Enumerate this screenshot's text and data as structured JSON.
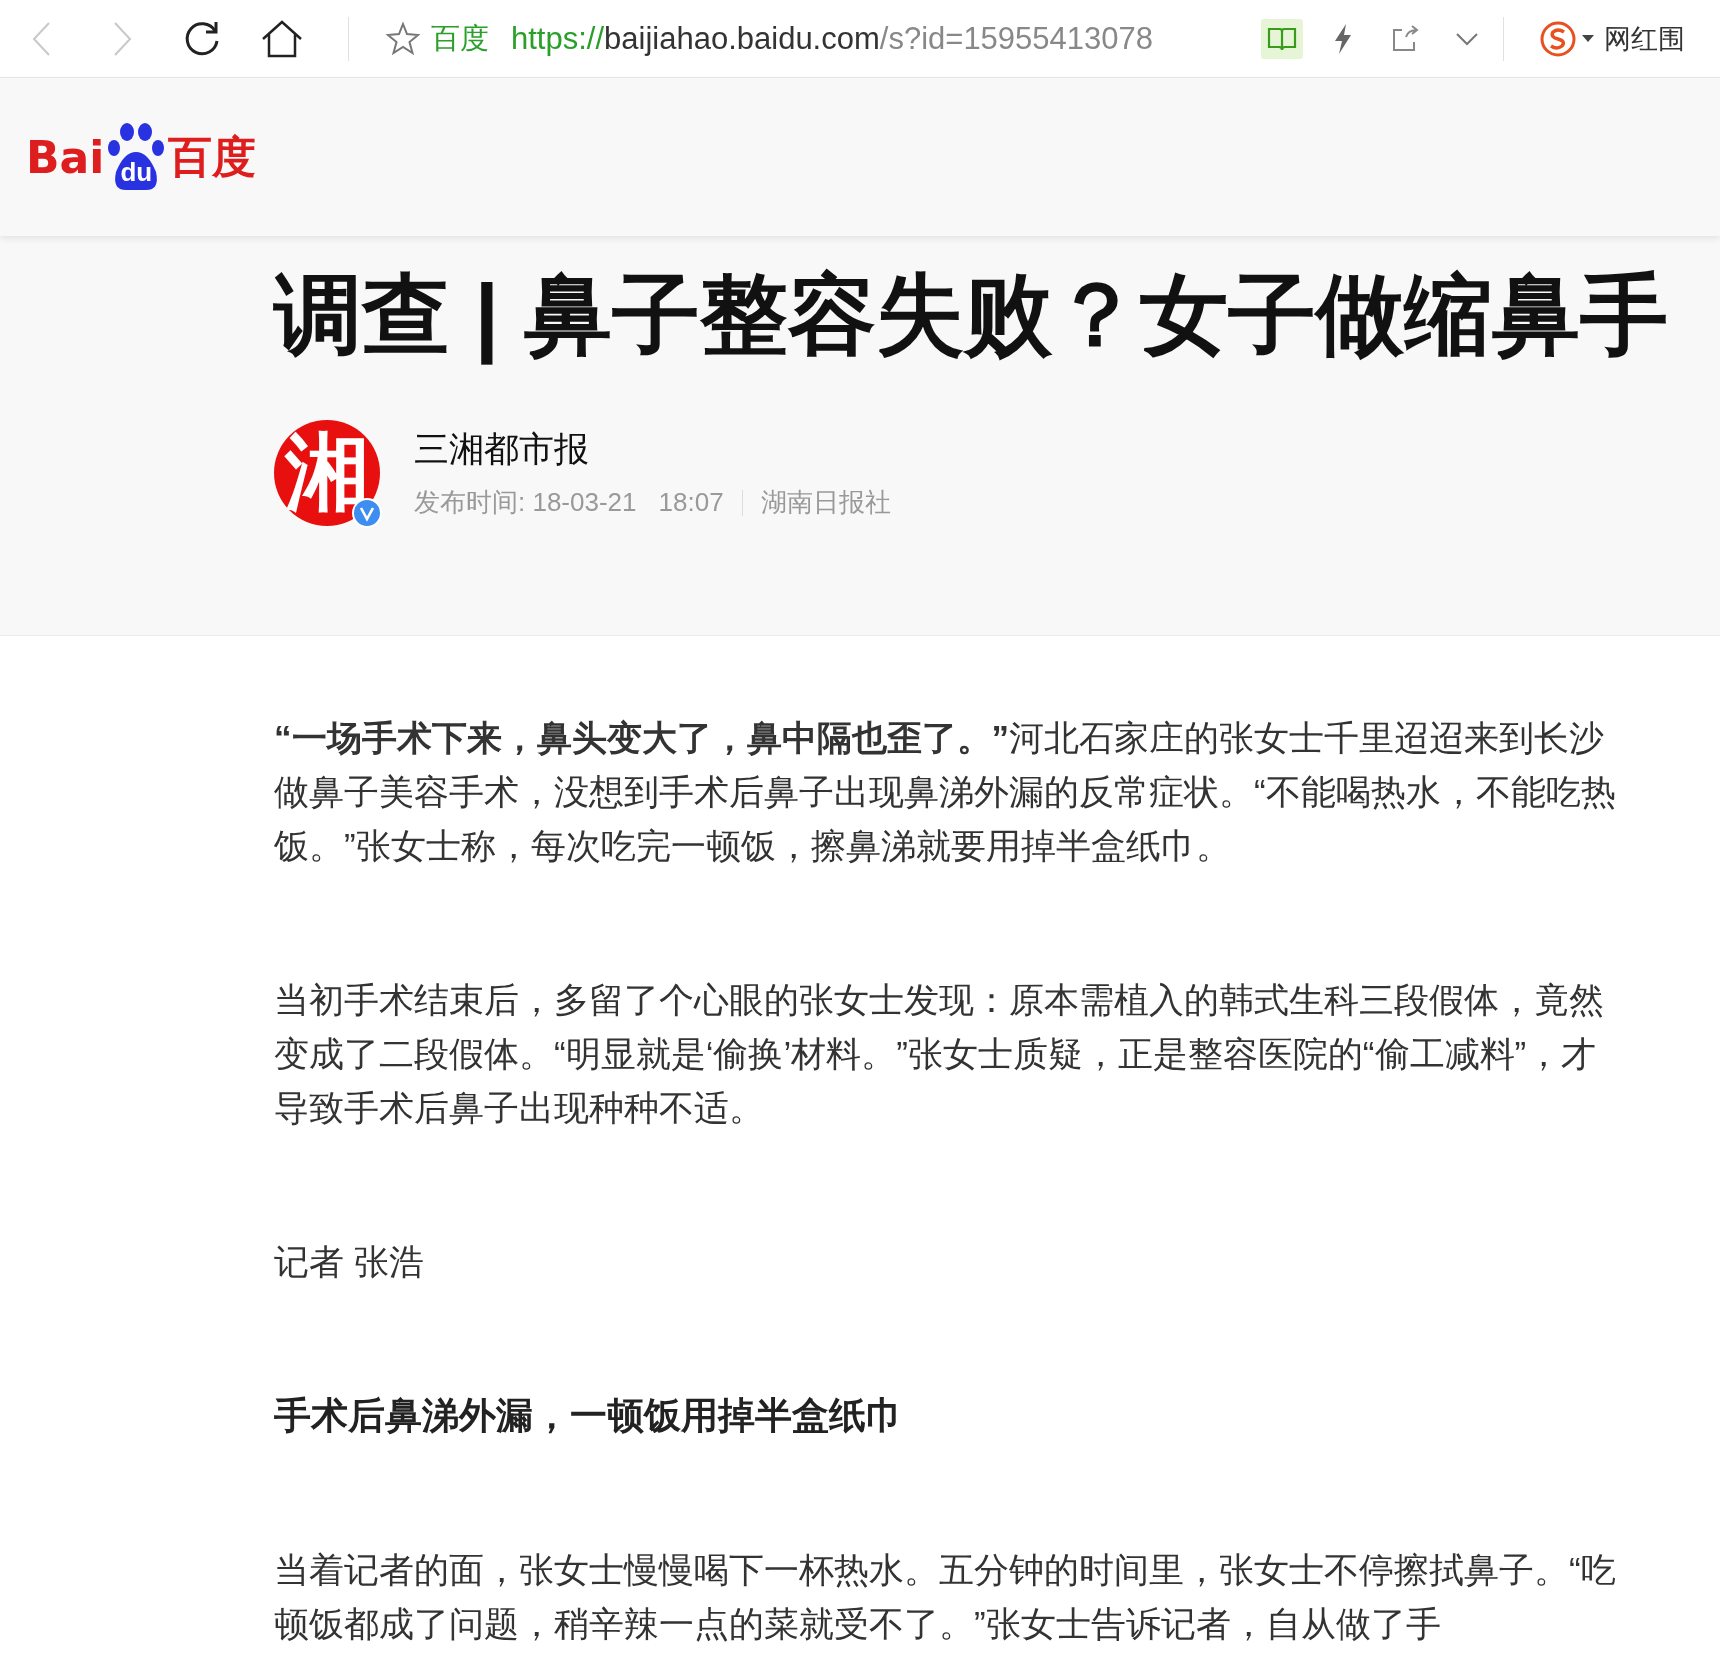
{
  "browser": {
    "back_disabled": true,
    "forward_disabled": true,
    "site_label": "百度",
    "url": {
      "scheme": "https://",
      "host": "baijiahao.baidu.com",
      "path": "/s?id=15955413078"
    },
    "search_text": "网红围"
  },
  "header": {
    "logo": {
      "left": "Bai",
      "mid": "du",
      "right": "百度"
    }
  },
  "article": {
    "title": "调查 | 鼻子整容失败？女子做缩鼻手",
    "author": {
      "avatar_text": "湘",
      "verified": true,
      "name": "三湘都市报",
      "published_label": "发布时间: 18-03-21",
      "time": "18:07",
      "source": "湖南日报社"
    },
    "blocks": [
      {
        "kind": "paragraph",
        "text": "**“一场手术下来，鼻头变大了，鼻中隔也歪了。”**河北石家庄的张女士千里迢迢来到长沙做鼻子美容手术，没想到手术后鼻子出现鼻涕外漏的反常症状。“不能喝热水，不能吃热饭。”张女士称，每次吃完一顿饭，擦鼻涕就要用掉半盒纸巾。"
      },
      {
        "kind": "paragraph",
        "text": "当初手术结束后，多留了个心眼的张女士发现：原本需植入的韩式生科三段假体，竟然变成了二段假体。“明显就是‘偷换’材料。”张女士质疑，正是整容医院的“偷工减料”，才导致手术后鼻子出现种种不适。"
      },
      {
        "kind": "paragraph",
        "text": "记者 张浩"
      },
      {
        "kind": "heading",
        "text": "手术后鼻涕外漏，一顿饭用掉半盒纸巾"
      },
      {
        "kind": "paragraph",
        "text": "当着记者的面，张女士慢慢喝下一杯热水。五分钟的时间里，张女士不停擦拭鼻子。“吃顿饭都成了问题，稍辛辣一点的菜就受不了。”张女士告诉记者，自从做了手"
      }
    ]
  }
}
